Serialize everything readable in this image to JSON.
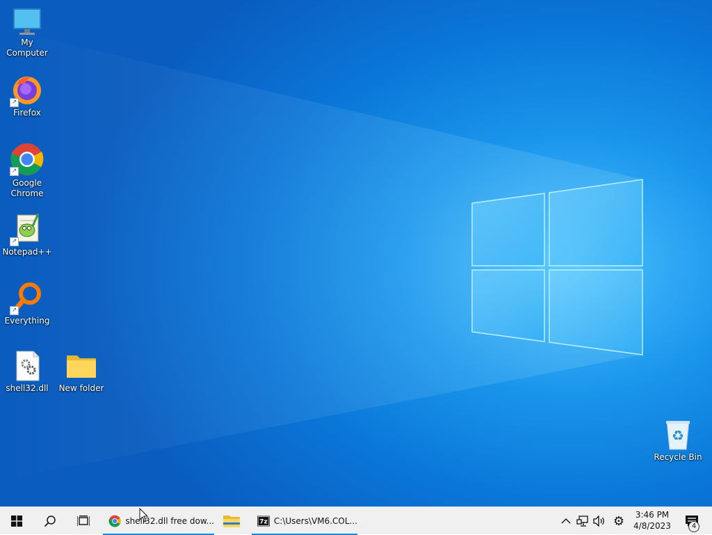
{
  "desktop": {
    "icons": [
      {
        "label": "My Computer",
        "icon": "monitor-icon"
      },
      {
        "label": "Firefox",
        "icon": "firefox-icon"
      },
      {
        "label": "Google Chrome",
        "icon": "chrome-icon"
      },
      {
        "label": "Notepad++",
        "icon": "notepadpp-icon"
      },
      {
        "label": "Everything",
        "icon": "search-magnifier-icon"
      },
      {
        "label": "shell32.dll",
        "icon": "dll-file-icon"
      },
      {
        "label": "New folder",
        "icon": "folder-icon"
      },
      {
        "label": "Recycle Bin",
        "icon": "recycle-bin-icon"
      }
    ]
  },
  "taskbar": {
    "apps": [
      {
        "title": "shell32.dll free dow...",
        "icon": "chrome-icon"
      },
      {
        "title": "",
        "icon": "file-explorer-icon"
      },
      {
        "title": "C:\\Users\\VM6.COL...",
        "icon": "7zip-icon"
      }
    ],
    "clock": {
      "time": "3:46 PM",
      "date": "4/8/2023"
    },
    "notifications": {
      "count": "4"
    },
    "colors": {
      "accent": "#1b86d8",
      "bar": "#f0f0f0"
    }
  }
}
